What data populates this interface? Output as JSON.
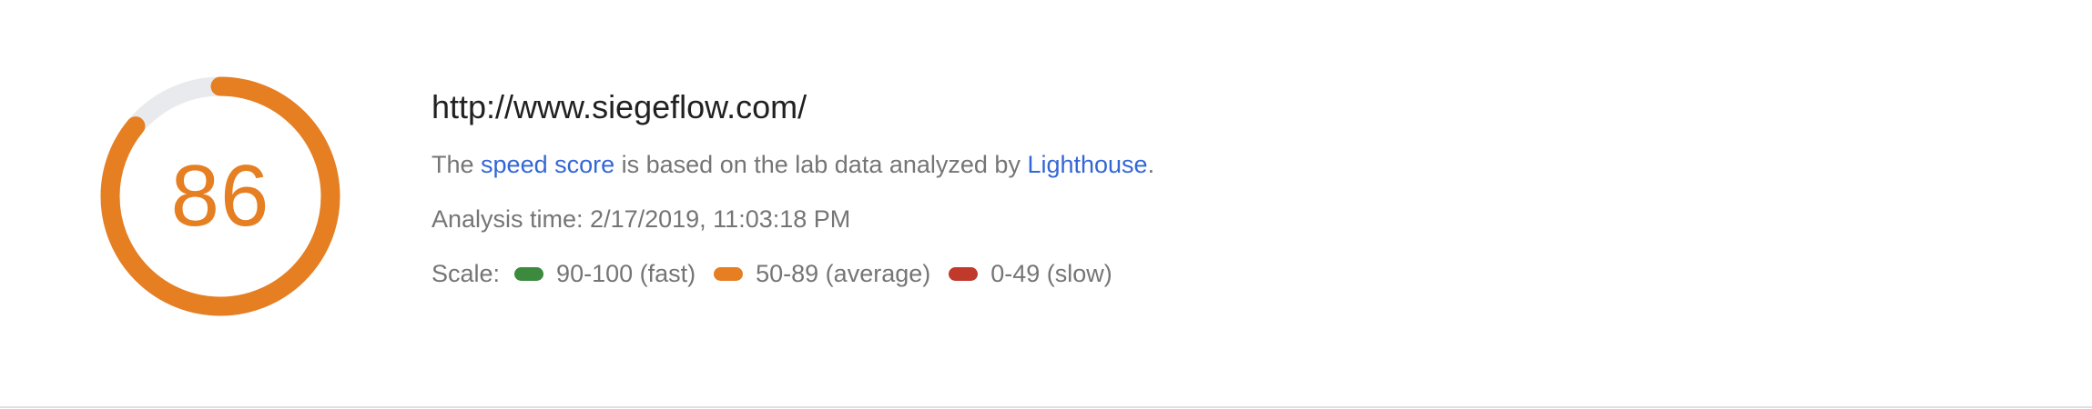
{
  "score": {
    "value": 86,
    "fraction": 0.86,
    "color": "#e67e22",
    "track_color": "#e8eaed"
  },
  "url": "http://www.siegeflow.com/",
  "description": {
    "prefix": "The ",
    "speed_score_link": "speed score",
    "middle": " is based on the lab data analyzed by ",
    "lighthouse_link": "Lighthouse",
    "suffix": "."
  },
  "analysis_time": "Analysis time: 2/17/2019, 11:03:18 PM",
  "scale": {
    "label": "Scale:",
    "items": [
      {
        "label": "90-100 (fast)",
        "color": "#3c8a3e"
      },
      {
        "label": "50-89 (average)",
        "color": "#e67e22"
      },
      {
        "label": "0-49 (slow)",
        "color": "#c0392b"
      }
    ]
  },
  "colors": {
    "link": "#3367d6",
    "text_primary": "#212121",
    "text_secondary": "#757575"
  }
}
